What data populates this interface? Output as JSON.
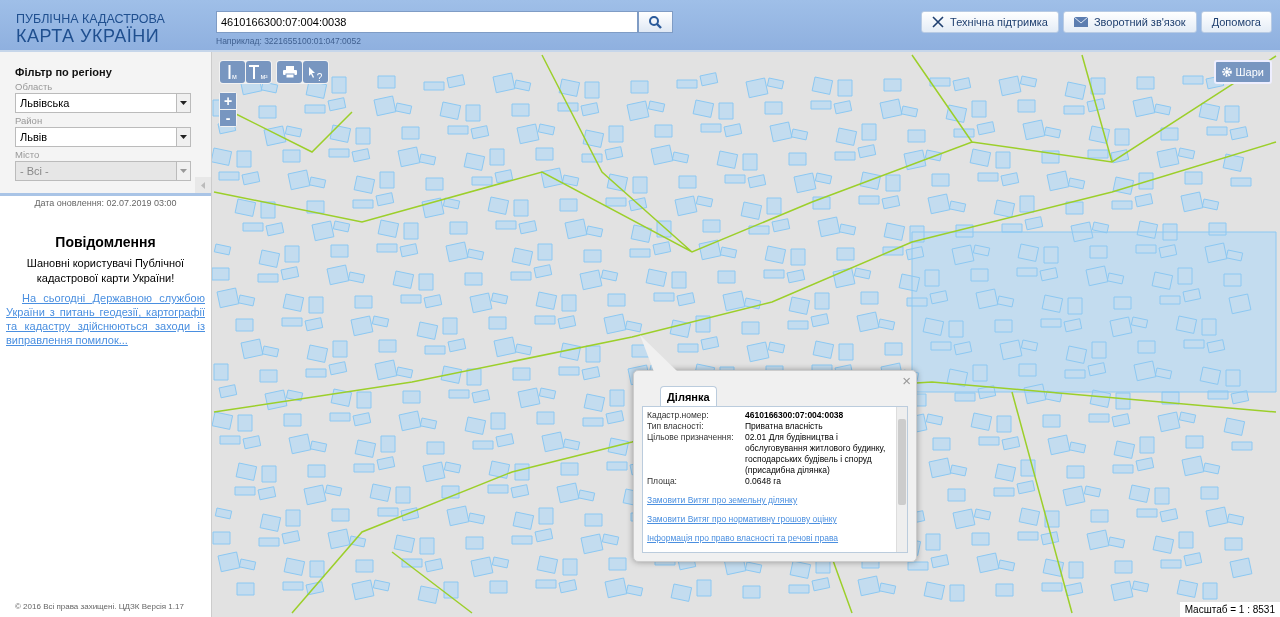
{
  "header": {
    "logo_top": "ПУБЛІЧНА КАДАСТРОВА",
    "logo_bottom": "КАРТА УКРАЇНИ",
    "search": {
      "value": "4610166300:07:004:0038",
      "hint": "Наприклад: 3221655100:01:047:0052"
    },
    "buttons": [
      {
        "kind": "support",
        "label": "Технічна підтримка"
      },
      {
        "kind": "feedback",
        "label": "Зворотний зв'язок"
      },
      {
        "kind": "help",
        "label": "Допомога"
      }
    ]
  },
  "sidebar": {
    "title": "Фільтр по регіону",
    "filters": [
      {
        "label": "Область",
        "value": "Львівська",
        "disabled": false
      },
      {
        "label": "Район",
        "value": "Львів",
        "disabled": false
      },
      {
        "label": "Місто",
        "value": "- Всі -",
        "disabled": true
      }
    ],
    "updated": "Дата оновлення: 02.07.2019 03:00",
    "notice_title": "Повідомлення",
    "notice_text": "Шановні користувачі Публічної кадастрової карти України!",
    "notice_link": "На сьогодні Державною службою України з питань геодезії, картографії та кадастру здійснюються заходи із виправлення помилок...",
    "footer": "© 2016 Всі права захищені. ЦДЗК Версія 1.17"
  },
  "map": {
    "tools": [
      {
        "kind": "distance",
        "label": "м"
      },
      {
        "kind": "area",
        "label": "м²"
      },
      {
        "kind": "print"
      },
      {
        "kind": "identify",
        "label": "?"
      }
    ],
    "zoom_in": "+",
    "zoom_out": "-",
    "layers_button": "Шари",
    "scale": "Масштаб = 1 : 8531",
    "popup": {
      "tab": {
        "label": "Ділянка",
        "selected": true
      },
      "close": "×",
      "fields": [
        {
          "label": "Кадастр.номер:",
          "value": "4610166300:07:004:0038",
          "bold": true
        },
        {
          "label": "Тип власності:",
          "value": "Приватна власність",
          "bold": false
        },
        {
          "label": "Цільове призначення:",
          "value": "02.01 Для будівництва і обслуговування житлового будинку, господарських будівель і споруд (присадибна ділянка)",
          "bold": false
        },
        {
          "label": "Площа:",
          "value": "0.0648 га",
          "bold": false
        }
      ],
      "links": [
        "Замовити Витяг про земельну ділянку",
        "Замовити Витяг про нормативну грошову оцінку",
        "Інформація про право власності та речові права"
      ]
    }
  }
}
